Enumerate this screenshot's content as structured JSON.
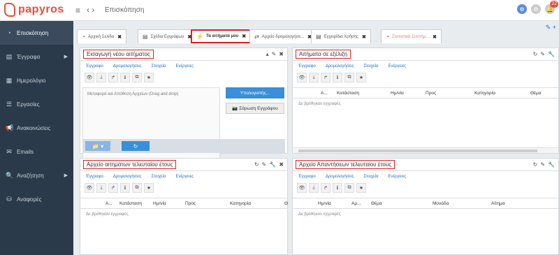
{
  "app": {
    "name": "papyros",
    "page_title": "Επισκόπηση",
    "notification_count": "22"
  },
  "sidebar": {
    "items": [
      {
        "label": "Επισκόπηση",
        "icon": "dashboard-icon",
        "active": true
      },
      {
        "label": "Έγγραφα",
        "icon": "document-icon",
        "arrow": true
      },
      {
        "label": "Ημερολόγιο",
        "icon": "calendar-icon"
      },
      {
        "label": "Εργασίες",
        "icon": "tasks-icon"
      },
      {
        "label": "Ανακοινώσεις",
        "icon": "megaphone-icon"
      },
      {
        "label": "Emails",
        "icon": "email-icon"
      },
      {
        "label": "Αναζήτηση",
        "icon": "search-icon",
        "arrow": true
      },
      {
        "label": "Αναφορές",
        "icon": "database-icon"
      }
    ]
  },
  "tabs": [
    {
      "label": "Αρχική Σελίδα"
    },
    {
      "label": "Σχέδια Εγγράφων"
    },
    {
      "label": "Τα αιτήματά μου",
      "active": true
    },
    {
      "label": "Αρχείο δρομολογήσε..."
    },
    {
      "label": "Εγχειρίδια Χρήσης"
    },
    {
      "label": "Στατιστικά Συστήμ..."
    }
  ],
  "subnav": [
    "Έγγραφο",
    "Δρομολογήσεις",
    "Στοιχεία",
    "Ενέργειες"
  ],
  "panels": {
    "new_request": {
      "title": "Εισαγωγή νέου αιτήματος",
      "dropzone": "Μεταφορά και Απόθεση Αρχείων (Drag and drop)",
      "compute_button": "Υπολογιστής...",
      "scan_button": "Σάρωση Εγγράφου"
    },
    "in_progress": {
      "title": "Αιτήματα σε εξέλιξη",
      "columns": [
        "Α...",
        "Κατάσταση",
        "Ημ/νία",
        "Προς",
        "Κατηγορία",
        "Θέμα"
      ],
      "empty": "Δε βρέθηκαν εγγραφές"
    },
    "archive_requests": {
      "title": "Αρχείο αιτημάτων τελευταίου έτους",
      "columns": [
        "Α...",
        "Κατάσταση",
        "Ημ/νία",
        "Προς",
        "Κατηγορία",
        "Θ"
      ],
      "empty": "Δε βρέθηκαν εγγραφές"
    },
    "archive_replies": {
      "title": "Αρχείο Απαντήσεων τελευταίου έτους",
      "columns": [
        "Ημ/νία",
        "Αρ...",
        "Θέμα",
        "Μονάδα",
        "Αίτημα"
      ],
      "empty": "Δε βρέθηκαν εγγραφές"
    }
  },
  "colors": {
    "accent": "#1e73be",
    "brand": "#e84c3d",
    "sidebar": "#2b3a4a",
    "highlight": "#e02020"
  }
}
